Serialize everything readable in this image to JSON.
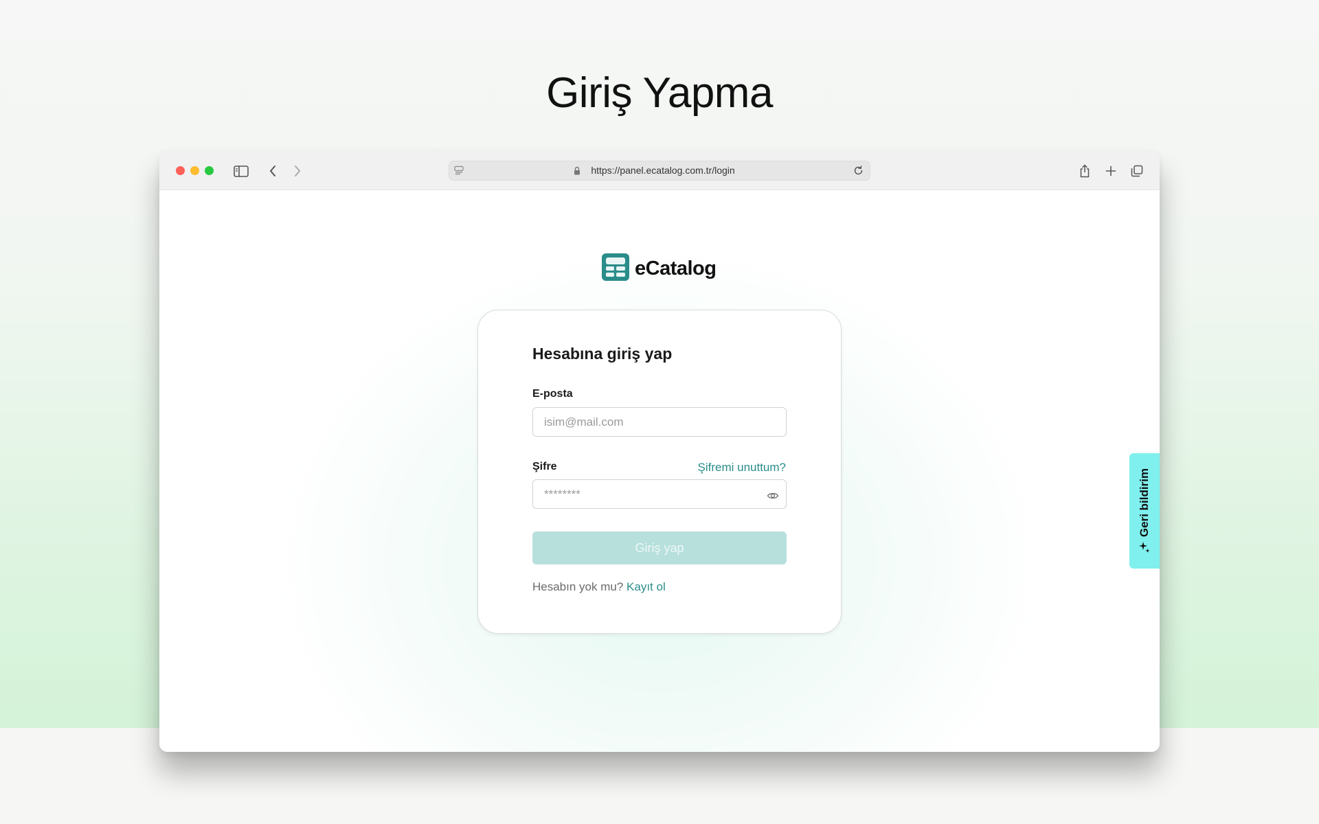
{
  "page": {
    "title": "Giriş Yapma"
  },
  "browser": {
    "url": "https://panel.ecatalog.com.tr/login",
    "icons": [
      "sidebar-icon",
      "back-icon",
      "forward-icon",
      "page-icon",
      "lock-icon",
      "reload-icon",
      "share-icon",
      "new-tab-icon",
      "tabs-overview-icon"
    ]
  },
  "brand": {
    "name": "eCatalog",
    "color": "#2a8d8a"
  },
  "login": {
    "heading": "Hesabına giriş yap",
    "email_label": "E-posta",
    "email_placeholder": "isim@mail.com",
    "password_label": "Şifre",
    "password_placeholder": "********",
    "forgot_label": "Şifremi unuttum?",
    "submit_label": "Giriş yap",
    "signup_prompt": "Hesabın yok mu?",
    "signup_link": "Kayıt ol"
  },
  "feedback": {
    "label": "Geri bildirim",
    "color": "#7ff0ee"
  }
}
